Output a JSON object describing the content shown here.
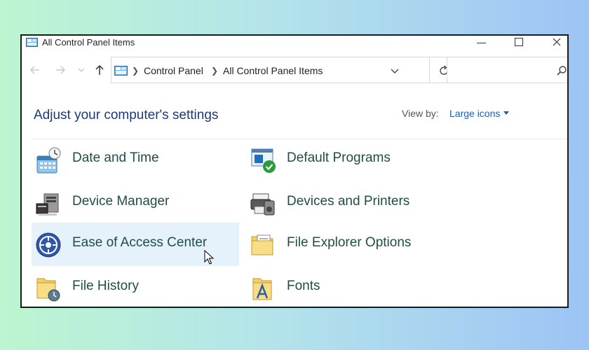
{
  "window": {
    "title": "All Control Panel Items"
  },
  "address": {
    "crumbs": [
      "Control Panel",
      "All Control Panel Items"
    ]
  },
  "search": {
    "placeholder": ""
  },
  "header": {
    "title": "Adjust your computer's settings",
    "view_by_label": "View by:",
    "view_by_value": "Large icons"
  },
  "items": [
    {
      "label": "Date and Time",
      "icon": "calendar-clock-icon"
    },
    {
      "label": "Default Programs",
      "icon": "default-programs-icon"
    },
    {
      "label": "Device Manager",
      "icon": "device-manager-icon"
    },
    {
      "label": "Devices and Printers",
      "icon": "printer-icon"
    },
    {
      "label": "Ease of Access Center",
      "icon": "ease-of-access-icon"
    },
    {
      "label": "File Explorer Options",
      "icon": "folder-options-icon"
    },
    {
      "label": "File History",
      "icon": "file-history-icon"
    },
    {
      "label": "Fonts",
      "icon": "fonts-folder-icon"
    }
  ],
  "colors": {
    "heading": "#1e3a78",
    "link": "#1a5fb4",
    "item_text": "#1f4e46",
    "hover_bg": "#e5f1fb"
  }
}
